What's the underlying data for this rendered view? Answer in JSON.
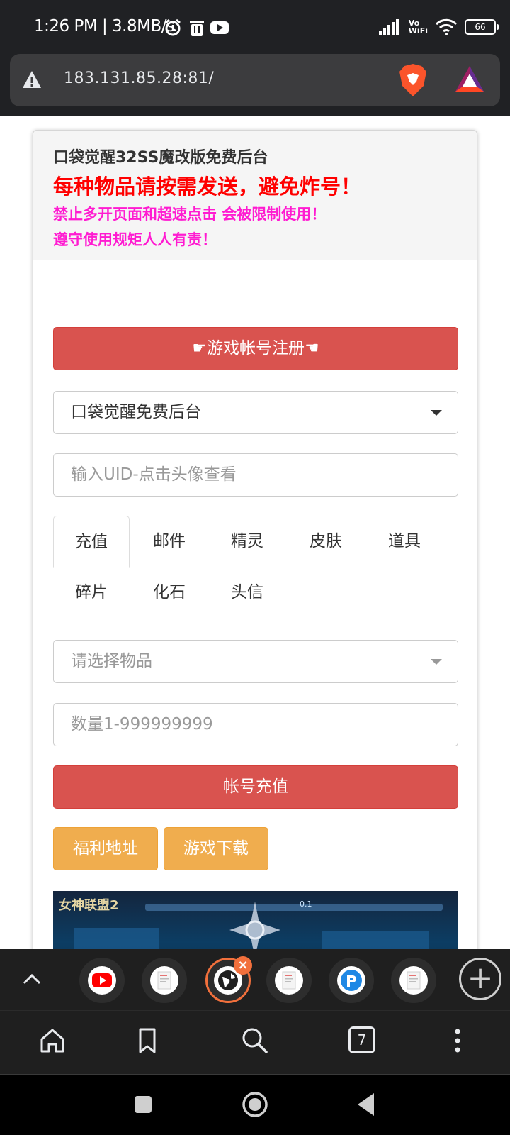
{
  "status_bar": {
    "time_and_speed": "1:26 PM | 3.8MB/s",
    "vowifi_top": "Vo",
    "vowifi_bottom": "WiFi",
    "battery": "66"
  },
  "address_bar": {
    "url": "183.131.85.28:81/"
  },
  "page": {
    "header_title": "口袋觉醒32SS魔改版免费后台",
    "header_warning": "每种物品请按需发送，避免炸号！",
    "header_note_1": "禁止多开页面和超速点击 会被限制使用！",
    "header_note_2": "遵守使用规矩人人有责！",
    "register_button": "☛游戏帐号注册☚",
    "server_select_value": "口袋觉醒免费后台",
    "uid_placeholder": "输入UID-点击头像查看",
    "tabs": [
      "充值",
      "邮件",
      "精灵",
      "皮肤",
      "道具",
      "碎片",
      "化石",
      "头信"
    ],
    "item_select_placeholder": "请选择物品",
    "quantity_placeholder": "数量1-999999999",
    "recharge_button": "帐号充值",
    "welfare_button": "福利地址",
    "download_button": "游戏下载",
    "banner_logo_text": "女神联盟2",
    "banner_version_text": "0.1"
  },
  "browser_tabs": {
    "count": "7"
  },
  "colors": {
    "danger": "#d9534f",
    "warning": "#f0ad4e",
    "header_red": "#ff0000",
    "header_pink": "#ff1bd1",
    "brave_orange": "#f2703c"
  },
  "icons": {
    "toolbar": [
      "home-icon",
      "bookmark-icon",
      "search-icon",
      "tabs-icon",
      "more-icon"
    ],
    "navigation": [
      "recents-icon",
      "home-circle-icon",
      "back-icon"
    ]
  }
}
